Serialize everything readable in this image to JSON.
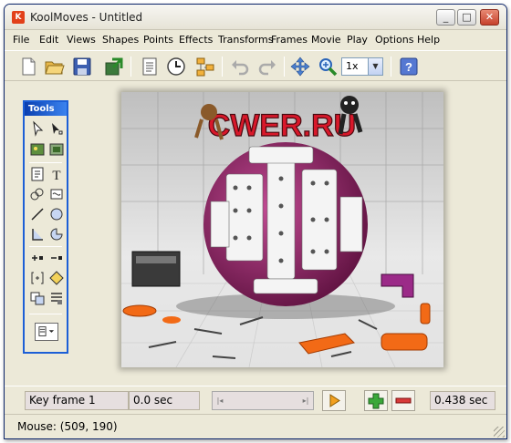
{
  "window": {
    "title": "KoolMoves - Untitled",
    "icon_letter": "K"
  },
  "title_buttons": {
    "minimize": "_",
    "maximize": "□",
    "close": "✕"
  },
  "menu": [
    "File",
    "Edit",
    "Views",
    "Shapes",
    "Points",
    "Effects",
    "Transforms",
    "Frames",
    "Movie",
    "Play",
    "Options",
    "Help"
  ],
  "toolbar": {
    "icons": [
      "new-file-icon",
      "open-folder-icon",
      "save-disk-icon",
      "export-icon",
      "notes-icon",
      "clock-icon",
      "frames-icon",
      "undo-icon",
      "redo-icon",
      "move-arrows-icon",
      "zoom-magnifier-icon",
      "help-icon"
    ],
    "zoom_value": "1x"
  },
  "tools": {
    "title": "Tools",
    "icons": [
      "arrow-select-icon",
      "subselect-icon",
      "image-tool-icon",
      "group-tool-icon",
      "text-frame-icon",
      "text-icon",
      "brush-icon",
      "shape-icon",
      "line-icon",
      "ellipse-icon",
      "corner-icon",
      "arc-icon",
      "add-point-icon",
      "delete-point-icon",
      "bracket-icon",
      "diamond-icon",
      "transform-icon",
      "align-icon",
      "fill-dropdown-icon"
    ]
  },
  "stage": {
    "logo_text": "CWER.RU",
    "colors": {
      "accent": "#a0286e",
      "logo_red": "#d8182a",
      "floor": "#e8e8e8",
      "orange": "#f26a16"
    }
  },
  "timeline": {
    "key_frame": "Key frame 1",
    "time": "0.0 sec",
    "duration": "0.438 sec"
  },
  "status": {
    "mouse": "Mouse: (509, 190)"
  }
}
